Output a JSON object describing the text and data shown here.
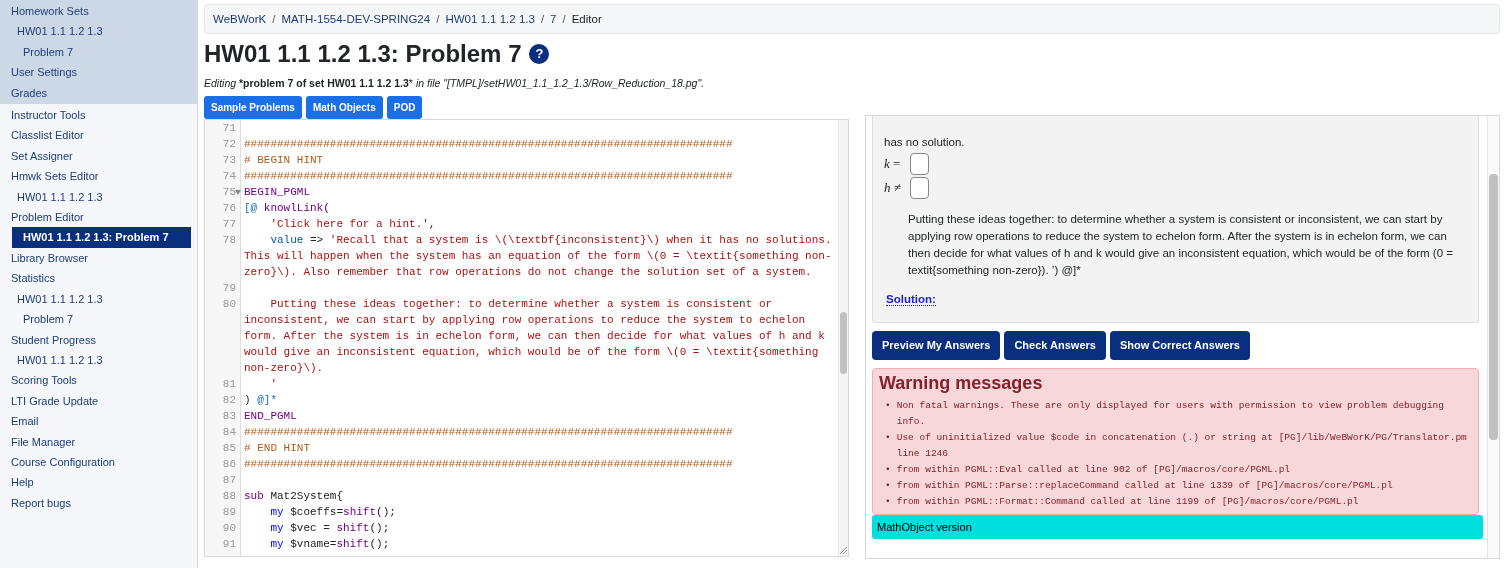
{
  "sidebar": {
    "sections": [
      {
        "kind": "student",
        "items": [
          {
            "label": "Homework Sets",
            "selected": false,
            "children": [
              {
                "label": "HW01 1.1 1.2 1.3",
                "selected": false,
                "children": [
                  {
                    "label": "Problem 7",
                    "selected": false
                  }
                ]
              }
            ]
          },
          {
            "label": "User Settings",
            "selected": false
          },
          {
            "label": "Grades",
            "selected": false
          }
        ]
      },
      {
        "kind": "instructor",
        "items": [
          {
            "label": "Instructor Tools",
            "selected": false
          },
          {
            "label": "Classlist Editor",
            "selected": false
          },
          {
            "label": "Set Assigner",
            "selected": false
          },
          {
            "label": "Hmwk Sets Editor",
            "selected": false,
            "children": [
              {
                "label": "HW01 1.1 1.2 1.3",
                "selected": false
              }
            ]
          },
          {
            "label": "Problem Editor",
            "selected": false,
            "children": [
              {
                "label": "HW01 1.1 1.2 1.3: Problem 7",
                "selected": true
              }
            ]
          },
          {
            "label": "Library Browser",
            "selected": false
          },
          {
            "label": "Statistics",
            "selected": false,
            "children": [
              {
                "label": "HW01 1.1 1.2 1.3",
                "selected": false,
                "children": [
                  {
                    "label": "Problem 7",
                    "selected": false
                  }
                ]
              }
            ]
          },
          {
            "label": "Student Progress",
            "selected": false,
            "children": [
              {
                "label": "HW01 1.1 1.2 1.3",
                "selected": false
              }
            ]
          },
          {
            "label": "Scoring Tools",
            "selected": false
          },
          {
            "label": "LTI Grade Update",
            "selected": false
          },
          {
            "label": "Email",
            "selected": false
          },
          {
            "label": "File Manager",
            "selected": false
          },
          {
            "label": "Course Configuration",
            "selected": false
          },
          {
            "label": "Help",
            "selected": false
          },
          {
            "label": "Report bugs",
            "selected": false
          }
        ]
      }
    ]
  },
  "breadcrumb": [
    {
      "label": "WeBWorK",
      "link": true
    },
    {
      "separator": "/",
      "label": "MATH-1554-DEV-SPRING24",
      "link": true
    },
    {
      "separator": "/",
      "label": "HW01 1.1 1.2 1.3",
      "link": true
    },
    {
      "separator": "/",
      "label": "7",
      "link": true
    },
    {
      "separator": "/",
      "label": "Editor",
      "link": false
    }
  ],
  "page_title": "HW01 1.1 1.2 1.3: Problem 7",
  "help_icon": "?",
  "subtitle": "*Editing* ***problem 7 of set HW01 1.1 1.2 1.3*** *in file \"[TMPL]/setHW01_1.1_1.2_1.3/Row_Reduction_18.pg\".*",
  "reference_buttons": [
    "Sample Problems",
    "Math Objects",
    "POD"
  ],
  "editor": {
    "lines": [
      {
        "number": "71"
      },
      {
        "number": "72",
        "tokens": [
          {
            "kind": "comment",
            "text": "##########################################################################"
          }
        ]
      },
      {
        "number": "73",
        "tokens": [
          {
            "kind": "comment",
            "text": "# BEGIN HINT"
          }
        ]
      },
      {
        "number": "74",
        "tokens": [
          {
            "kind": "comment",
            "text": "##########################################################################"
          }
        ]
      },
      {
        "number": "75",
        "foldable": true,
        "tokens": [
          {
            "kind": "keyword",
            "text": "BEGIN_PGML"
          }
        ]
      },
      {
        "number": "76",
        "tokens": [
          {
            "kind": "pgml",
            "text": "[@"
          },
          {
            "kind": "keyword",
            "text": " knowlLink"
          },
          {
            "kind": "plain",
            "text": "("
          }
        ]
      },
      {
        "number": "77",
        "tokens": [
          {
            "kind": "string",
            "text": "    'Click here for a hint.'"
          },
          {
            "kind": "plain",
            "text": ","
          }
        ]
      },
      {
        "number": "78",
        "tokens": [
          {
            "kind": "attribute",
            "text": "    value"
          },
          {
            "kind": "plain",
            "text": " => "
          },
          {
            "kind": "string",
            "text": "'Recall that a system is \\(\\textbf{inconsistent}\\) when it has no solutions. This will happen when the system has an equation of the form \\(0 = \\textit{something non-zero}\\). Also remember that row operations do not change the solution set of a system."
          }
        ]
      },
      {
        "number": "79"
      },
      {
        "number": "80",
        "tokens": [
          {
            "kind": "string",
            "text": "    Putting these ideas together: to determine whether a system is consistent or inconsistent, we can start by applying row operations to reduce the system to echelon form. After the system is in echelon form, we can then decide for what values of h and k would give an inconsistent equation, which would be of the form \\(0 = \\textit{something non-zero}\\)."
          }
        ]
      },
      {
        "number": "81",
        "tokens": [
          {
            "kind": "string",
            "text": "    '"
          }
        ]
      },
      {
        "number": "82",
        "tokens": [
          {
            "kind": "plain",
            "text": ") "
          },
          {
            "kind": "pgml",
            "text": "@]*"
          }
        ]
      },
      {
        "number": "83",
        "tokens": [
          {
            "kind": "keyword",
            "text": "END_PGML"
          }
        ]
      },
      {
        "number": "84",
        "tokens": [
          {
            "kind": "comment",
            "text": "##########################################################################"
          }
        ]
      },
      {
        "number": "85",
        "tokens": [
          {
            "kind": "comment",
            "text": "# END HINT"
          }
        ]
      },
      {
        "number": "86",
        "tokens": [
          {
            "kind": "comment",
            "text": "##########################################################################"
          }
        ]
      },
      {
        "number": "87"
      },
      {
        "number": "88",
        "tokens": [
          {
            "kind": "keyword",
            "text": "sub"
          },
          {
            "kind": "plain",
            "text": " Mat2System{"
          }
        ]
      },
      {
        "number": "89",
        "tokens": [
          {
            "kind": "def",
            "text": "    my"
          },
          {
            "kind": "plain",
            "text": " $coeffs="
          },
          {
            "kind": "keyword",
            "text": "shift"
          },
          {
            "kind": "plain",
            "text": "();"
          }
        ]
      },
      {
        "number": "90",
        "tokens": [
          {
            "kind": "def",
            "text": "    my"
          },
          {
            "kind": "plain",
            "text": " $vec = "
          },
          {
            "kind": "keyword",
            "text": "shift"
          },
          {
            "kind": "plain",
            "text": "();"
          }
        ]
      },
      {
        "number": "91",
        "tokens": [
          {
            "kind": "def",
            "text": "    my"
          },
          {
            "kind": "plain",
            "text": " $vname="
          },
          {
            "kind": "keyword",
            "text": "shift"
          },
          {
            "kind": "plain",
            "text": "();"
          }
        ]
      }
    ]
  },
  "preview": {
    "text": "has no solution.",
    "answers": [
      {
        "label": "*k* ="
      },
      {
        "label": "*h* ≠"
      }
    ],
    "paragraph": "Putting these ideas together: to determine whether a system is consistent or inconsistent, we can start by applying row operations to reduce the system to echelon form. After the system is in echelon form, we can then decide for what values of h and k would give an inconsistent equation, which would be of the form (0 = textit{something non-zero}). ’) @]*",
    "solution_link": "Solution:"
  },
  "answer_buttons": [
    "Preview My Answers",
    "Check Answers",
    "Show Correct Answers"
  ],
  "warnings": {
    "title": "Warning messages",
    "items": [
      {
        "bullet": "•",
        "text": "Non fatal warnings. These are only displayed for users with permission to view problem debugging info."
      },
      {
        "bullet": "•",
        "text": "Use of uninitialized value $code in concatenation (.) or string at [PG]/lib/WeBWorK/PG/Translator.pm line 1246"
      },
      {
        "bullet": "•",
        "text": "from within PGML::Eval called at line 902 of [PG]/macros/core/PGML.pl"
      },
      {
        "bullet": "•",
        "text": "from within PGML::Parse::replaceCommand called at line 1339 of [PG]/macros/core/PGML.pl"
      },
      {
        "bullet": "•",
        "text": "from within PGML::Format::Command called at line 1199 of [PG]/macros/core/PGML.pl"
      }
    ]
  },
  "version_bar": "MathObject version"
}
